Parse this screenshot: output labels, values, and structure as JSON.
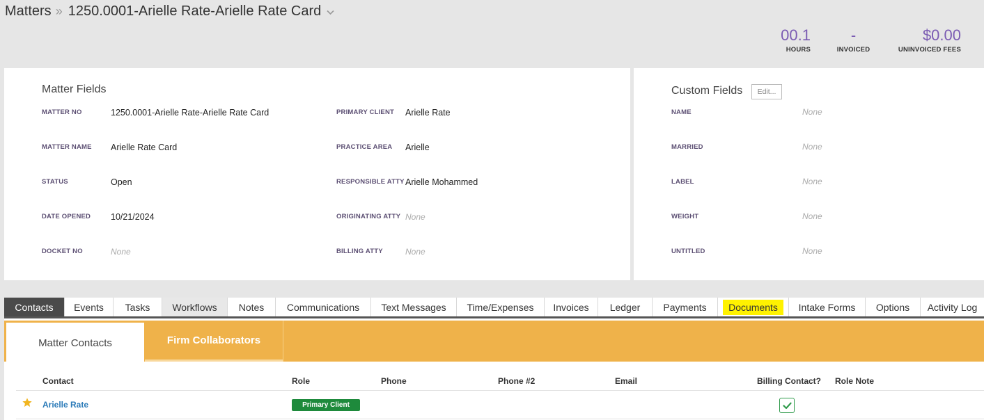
{
  "breadcrumb": {
    "root": "Matters",
    "separator": "»",
    "current": "1250.0001-Arielle Rate-Arielle Rate Card"
  },
  "stats": {
    "hours": {
      "value": "00.1",
      "label": "HOURS"
    },
    "invoiced": {
      "value": "-",
      "label": "INVOICED"
    },
    "uninvoiced": {
      "value": "$0.00",
      "label": "UNINVOICED FEES"
    }
  },
  "matter_fields": {
    "title": "Matter Fields",
    "left": [
      {
        "label": "MATTER NO",
        "value": "1250.0001-Arielle Rate-Arielle Rate Card"
      },
      {
        "label": "MATTER NAME",
        "value": "Arielle Rate Card"
      },
      {
        "label": "STATUS",
        "value": "Open"
      },
      {
        "label": "DATE OPENED",
        "value": "10/21/2024"
      },
      {
        "label": "DOCKET NO",
        "value": "None"
      }
    ],
    "right": [
      {
        "label": "PRIMARY CLIENT",
        "value": "Arielle Rate"
      },
      {
        "label": "PRACTICE AREA",
        "value": "Arielle"
      },
      {
        "label": "RESPONSIBLE ATTY",
        "value": "Arielle Mohammed"
      },
      {
        "label": "ORIGINATING ATTY",
        "value": "None"
      },
      {
        "label": "BILLING ATTY",
        "value": "None"
      }
    ]
  },
  "custom_fields": {
    "title": "Custom Fields",
    "edit_label": "Edit...",
    "fields": [
      {
        "label": "NAME",
        "value": "None"
      },
      {
        "label": "MARRIED",
        "value": "None"
      },
      {
        "label": "LABEL",
        "value": "None"
      },
      {
        "label": "WEIGHT",
        "value": "None"
      },
      {
        "label": "UNTITLED",
        "value": "None"
      }
    ]
  },
  "tabs": [
    "Contacts",
    "Events",
    "Tasks",
    "Workflows",
    "Notes",
    "Communications",
    "Text Messages",
    "Time/Expenses",
    "Invoices",
    "Ledger",
    "Payments",
    "Documents",
    "Intake Forms",
    "Options",
    "Activity Log"
  ],
  "subtabs": {
    "matter_contacts": "Matter Contacts",
    "firm_collaborators": "Firm Collaborators"
  },
  "contacts_table": {
    "headers": [
      "Contact",
      "Role",
      "Phone",
      "Phone #2",
      "Email",
      "Billing Contact?",
      "Role Note"
    ],
    "rows": [
      {
        "contact": "Arielle Rate",
        "role": "Primary Client",
        "phone": "",
        "phone2": "",
        "email": "",
        "billing_contact": true,
        "role_note": ""
      }
    ]
  },
  "colors": {
    "accent_purple": "#7b5cb3",
    "subtab_orange": "#efb24a",
    "badge_green": "#1e8a3c",
    "highlight_yellow": "#fff200",
    "link_blue": "#2a7ab8"
  }
}
